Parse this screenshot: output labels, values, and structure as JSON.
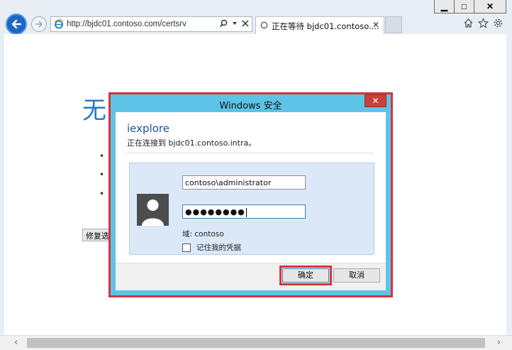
{
  "browser": {
    "url": "http://bjdc01.contoso.com/certsrv",
    "tab_title": "正在等待 bjdc01.contoso....",
    "window_controls": {
      "minimize": "▁",
      "maximize": "□",
      "close": "✕"
    },
    "icons": [
      "back-icon",
      "forward-icon",
      "ie-icon",
      "search-icon",
      "dropdown-icon",
      "stop-icon",
      "spinner-icon",
      "home-icon",
      "favorites-icon",
      "settings-icon"
    ]
  },
  "background_page": {
    "heading": "无",
    "bullets": [
      "•",
      "•",
      "•"
    ],
    "button_label": "修复选"
  },
  "dialog": {
    "title": "Windows 安全",
    "close_label": "✕",
    "app_name": "iexplore",
    "connecting_text": "正在连接到 bjdc01.contoso.intra。",
    "username_value": "contoso\\administrator",
    "password_mask": "●●●●●●●●",
    "domain_text": "域: contoso",
    "remember_label": "记住我的凭据",
    "ok_label": "确定",
    "cancel_label": "取消"
  },
  "colors": {
    "dialog_frame": "#5dc4e8",
    "highlight": "#d4353d",
    "link_blue": "#2a7cc7"
  }
}
